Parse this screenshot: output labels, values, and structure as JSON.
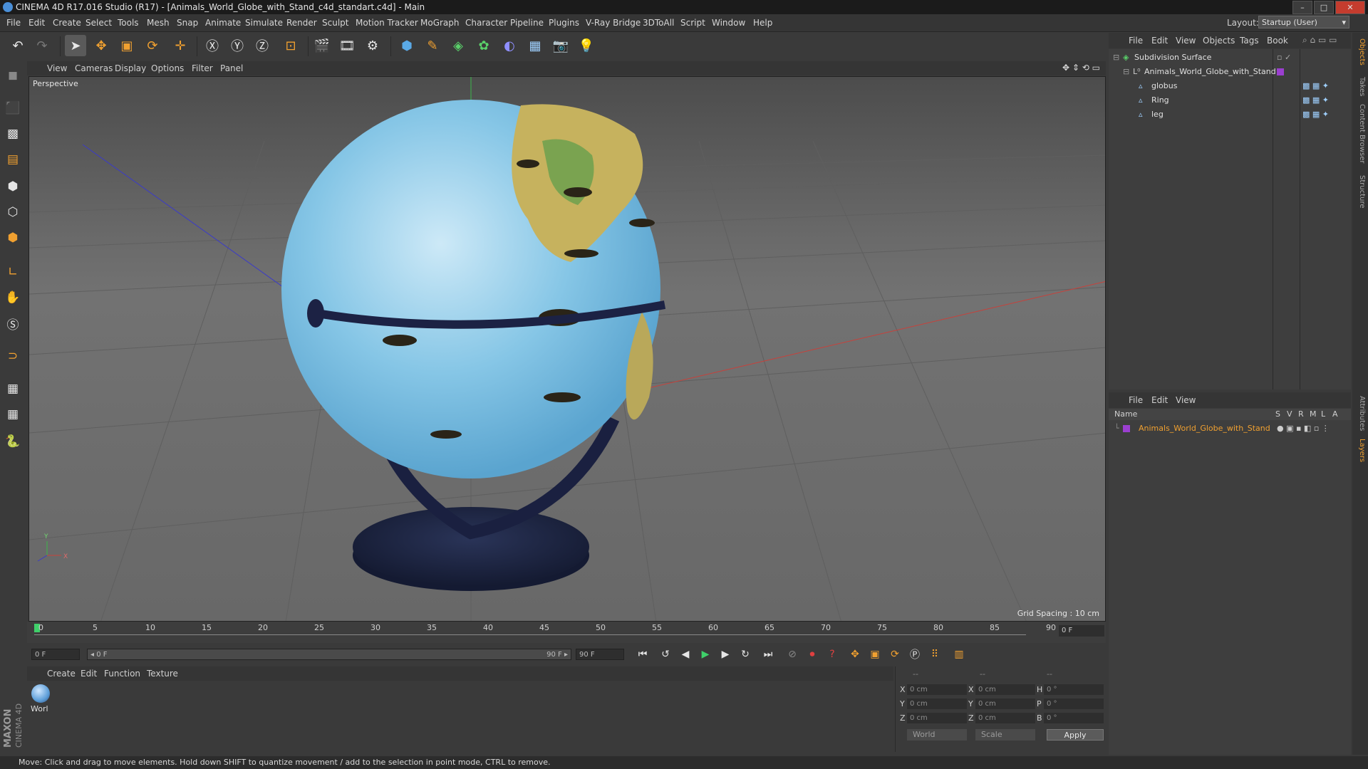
{
  "window": {
    "title": "CINEMA 4D R17.016 Studio (R17) - [Animals_World_Globe_with_Stand_c4d_standart.c4d] - Main",
    "buttons": [
      "–",
      "□",
      "✕"
    ]
  },
  "menubar": {
    "items": [
      "File",
      "Edit",
      "Create",
      "Select",
      "Tools",
      "Mesh",
      "Snap",
      "Animate",
      "Simulate",
      "Render",
      "Sculpt",
      "Motion Tracker",
      "MoGraph",
      "Character",
      "Pipeline",
      "Plugins",
      "V-Ray Bridge",
      "3DToAll",
      "Script",
      "Window",
      "Help"
    ],
    "layout_label": "Layout:",
    "layout_value": "Startup (User)"
  },
  "viewport": {
    "menu": [
      "View",
      "Cameras",
      "Display",
      "Options",
      "Filter",
      "Panel"
    ],
    "label": "Perspective",
    "grid_spacing": "Grid Spacing : 10 cm",
    "axis_y": "Y",
    "axis_x": "X"
  },
  "timeline": {
    "ticks": [
      "0",
      "5",
      "10",
      "15",
      "20",
      "25",
      "30",
      "35",
      "40",
      "45",
      "50",
      "55",
      "60",
      "65",
      "70",
      "75",
      "80",
      "85",
      "90"
    ],
    "frame_end_field": "0 F",
    "start_field": "0 F",
    "range_left": "◂ 0 F",
    "range_right": "90 F ▸",
    "end_field": "90 F"
  },
  "materials": {
    "menu": [
      "Create",
      "Edit",
      "Function",
      "Texture"
    ],
    "items": [
      {
        "name": "Worl"
      }
    ]
  },
  "coordinates": {
    "headers": [
      "--",
      "--",
      "--"
    ],
    "rows": [
      {
        "a": "X",
        "av": "0 cm",
        "b": "X",
        "bv": "0 cm",
        "c": "H",
        "cv": "0 °"
      },
      {
        "a": "Y",
        "av": "0 cm",
        "b": "Y",
        "bv": "0 cm",
        "c": "P",
        "cv": "0 °"
      },
      {
        "a": "Z",
        "av": "0 cm",
        "b": "Z",
        "bv": "0 cm",
        "c": "B",
        "cv": "0 °"
      }
    ],
    "mode": "World",
    "transform": "Scale",
    "apply": "Apply"
  },
  "objects_panel": {
    "menu": [
      "File",
      "Edit",
      "View",
      "Objects",
      "Tags",
      "Book"
    ],
    "tree": [
      {
        "name": "Subdivision Surface",
        "level": 0
      },
      {
        "name": "Animals_World_Globe_with_Stand",
        "level": 1
      },
      {
        "name": "globus",
        "level": 2
      },
      {
        "name": "Ring",
        "level": 2
      },
      {
        "name": "leg",
        "level": 2
      }
    ]
  },
  "layers_panel": {
    "menu": [
      "File",
      "Edit",
      "View"
    ],
    "columns": [
      "Name",
      "S",
      "V",
      "R",
      "M",
      "L",
      "A"
    ],
    "rows": [
      {
        "name": "Animals_World_Globe_with_Stand",
        "color": "#9b3fd0"
      }
    ]
  },
  "right_tabs": [
    "Objects",
    "Takes",
    "Content Browser",
    "Structure",
    "Attributes",
    "Layers"
  ],
  "brand": {
    "maxon": "MAXON",
    "c4d": "CINEMA 4D"
  },
  "status": "Move: Click and drag to move elements. Hold down SHIFT to quantize movement / add to the selection in point mode, CTRL to remove.",
  "colors": {
    "accent": "#f0a030",
    "layer_color": "#9b3fd0"
  }
}
